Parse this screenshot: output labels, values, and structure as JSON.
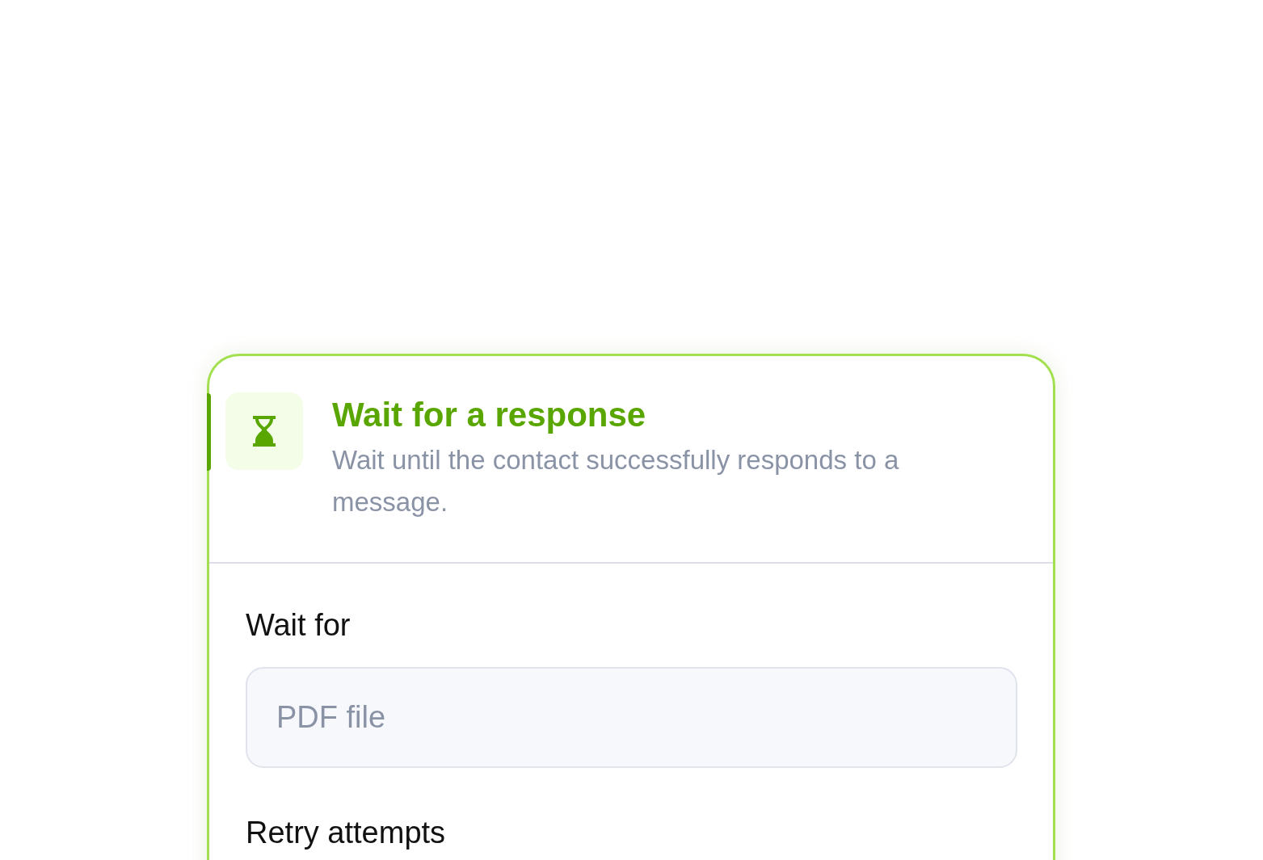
{
  "step": {
    "title": "Wait for a response",
    "description": "Wait until the contact successfully responds to a message.",
    "active": true
  },
  "fields": [
    {
      "kind": "input",
      "label": "Wait for",
      "placeholder": "PDF file"
    },
    {
      "kind": "heading",
      "label": "Retry attempts"
    }
  ]
}
